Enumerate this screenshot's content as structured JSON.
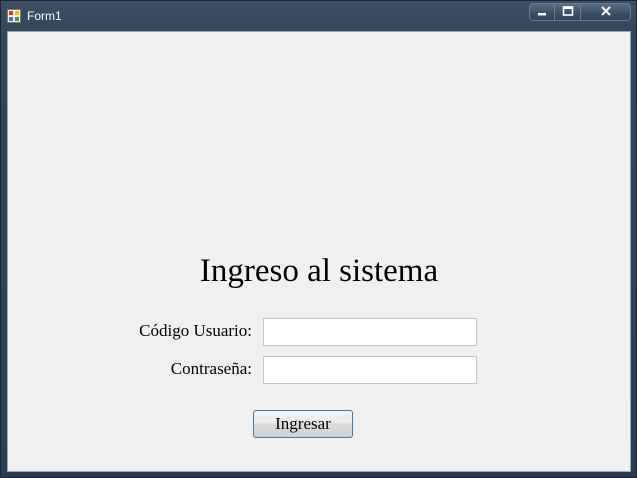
{
  "window": {
    "title": "Form1",
    "icon": "winforms-app-icon",
    "caption_buttons": [
      "minimize-icon",
      "maximize-icon",
      "close-icon"
    ]
  },
  "form": {
    "heading": "Ingreso al sistema",
    "user_label": "Código Usuario:",
    "user_value": "",
    "password_label": "Contraseña:",
    "password_value": "",
    "submit_label": "Ingresar"
  },
  "colors": {
    "client_background": "#f0f0f0",
    "titlebar": "#33465c",
    "button_focus_border": "#3c7fb1"
  }
}
